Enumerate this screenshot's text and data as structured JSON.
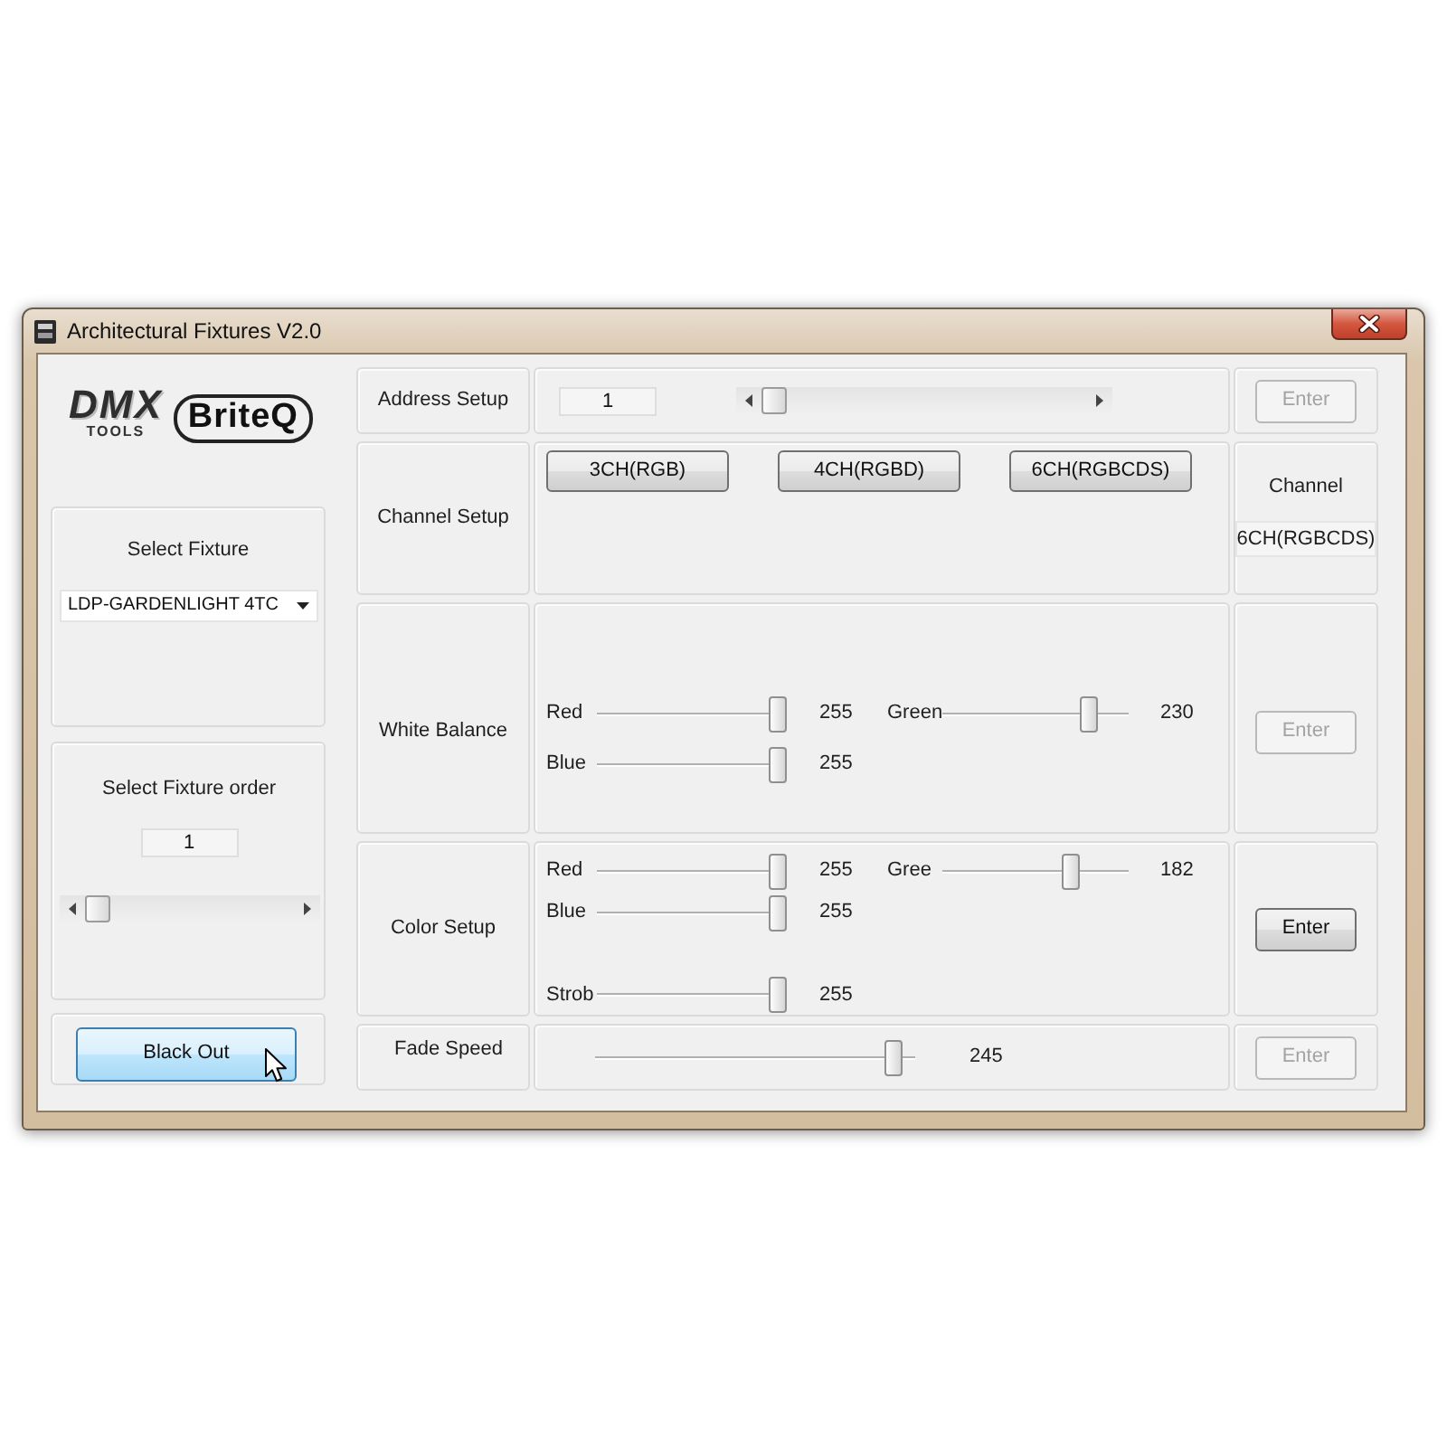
{
  "window": {
    "title": "Architectural Fixtures V2.0"
  },
  "logos": [
    {
      "kind": "outline",
      "text": "DMX",
      "subtext": "TOOLS"
    },
    {
      "kind": "badge",
      "text": "BriteQ"
    }
  ],
  "fixture": {
    "label": "Select Fixture",
    "value": "LDP-GARDENLIGHT 4TC"
  },
  "fixture_order": {
    "label": "Select Fixture order",
    "value": "1",
    "scrollbar": {
      "level": 0
    }
  },
  "black_out": {
    "label": "Black Out",
    "hovered": true
  },
  "address_setup": {
    "label": "Address Setup",
    "value": "1",
    "scrollbar": {
      "level": 0
    },
    "enter": {
      "label": "Enter",
      "disabled": true
    }
  },
  "channel_setup": {
    "label": "Channel Setup",
    "buttons": [
      {
        "label": "3CH(RGB)"
      },
      {
        "label": "4CH(RGBD)"
      },
      {
        "label": "6CH(RGBCDS)"
      }
    ],
    "channel": {
      "label": "Channel",
      "value": "6CH(RGBCDS)"
    }
  },
  "white_balance": {
    "label": "White Balance",
    "sliders": [
      {
        "name": "Red",
        "level": 1,
        "reading": "255"
      },
      {
        "name": "Green",
        "level": 0.82,
        "reading": "230"
      },
      {
        "name": "Blue",
        "level": 1,
        "reading": "255"
      }
    ],
    "enter": {
      "label": "Enter",
      "disabled": true
    }
  },
  "color_setup": {
    "label": "Color Setup",
    "sliders": [
      {
        "name": "Red",
        "level": 1,
        "reading": "255"
      },
      {
        "name": "Gree",
        "level": 0.72,
        "reading": "182"
      },
      {
        "name": "Blue",
        "level": 1,
        "reading": "255"
      },
      {
        "name": "Strob",
        "level": 1,
        "reading": "255"
      }
    ],
    "enter": {
      "label": "Enter",
      "disabled": false
    }
  },
  "fade_speed": {
    "label": "Fade Speed",
    "slider": {
      "level": 0.96,
      "reading": "245"
    },
    "enter": {
      "label": "Enter",
      "disabled": true
    }
  }
}
